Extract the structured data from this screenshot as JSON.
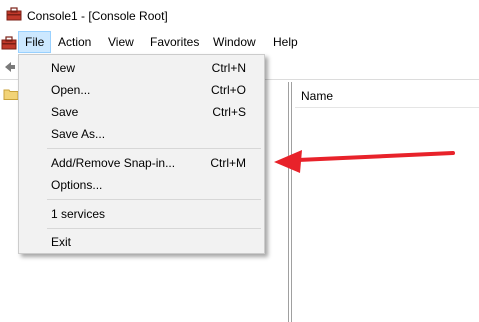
{
  "window": {
    "title": "Console1 - [Console Root]"
  },
  "menubar": {
    "items": [
      {
        "label": "File",
        "open": true
      },
      {
        "label": "Action"
      },
      {
        "label": "View"
      },
      {
        "label": "Favorites"
      },
      {
        "label": "Window"
      },
      {
        "label": "Help"
      }
    ]
  },
  "file_menu": {
    "items": [
      {
        "label": "New",
        "shortcut": "Ctrl+N"
      },
      {
        "label": "Open...",
        "shortcut": "Ctrl+O"
      },
      {
        "label": "Save",
        "shortcut": "Ctrl+S"
      },
      {
        "label": "Save As...",
        "shortcut": ""
      },
      {
        "label": "Add/Remove Snap-in...",
        "shortcut": "Ctrl+M"
      },
      {
        "label": "Options...",
        "shortcut": ""
      },
      {
        "label": "1 services",
        "shortcut": ""
      },
      {
        "label": "Exit",
        "shortcut": ""
      }
    ]
  },
  "result_pane": {
    "column_header": "Name"
  },
  "colors": {
    "menu_bg": "#f2f2f2",
    "menu_open_bg": "#cce8ff",
    "arrow": "#e8222a"
  },
  "icons": [
    "console-icon",
    "toolbox-icon",
    "back-arrow-icon",
    "folder-icon",
    "annotation-arrow"
  ]
}
